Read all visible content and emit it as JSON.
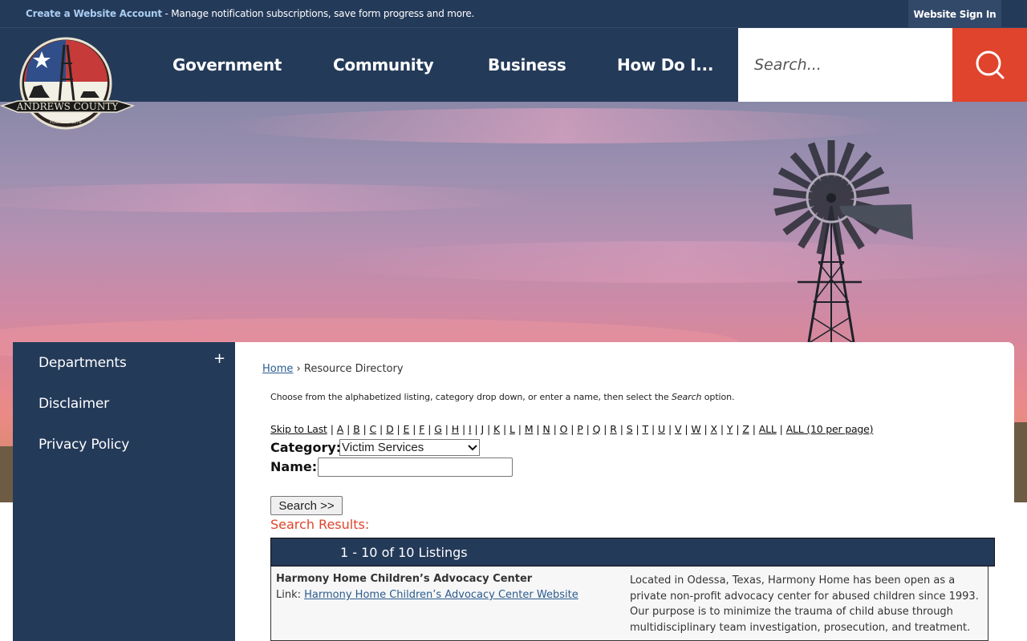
{
  "topbar": {
    "create_account": "Create a Website Account",
    "message": " - Manage notification subscriptions, save form progress and more.",
    "sign_in": "Website Sign In"
  },
  "logo": {
    "text": "ANDREWS COUNTY",
    "subtext": "FOUNDED 1876"
  },
  "nav": {
    "items": [
      "Government",
      "Community",
      "Business",
      "How Do I..."
    ]
  },
  "search": {
    "placeholder": "Search..."
  },
  "sidebar": {
    "items": [
      "Departments",
      "Disclaimer",
      "Privacy Policy"
    ],
    "expand_symbol": "+"
  },
  "breadcrumb": {
    "home": "Home",
    "separator": "›",
    "current": "Resource Directory"
  },
  "intro": {
    "text": "Choose from the alphabetized listing, category drop down, or enter a name, then select the ",
    "search_word": "Search",
    "suffix": " option."
  },
  "alphabet": {
    "skip_to_last": "Skip to Last",
    "letters": [
      "A",
      "B",
      "C",
      "D",
      "E",
      "F",
      "G",
      "H",
      "I",
      "J",
      "K",
      "L",
      "M",
      "N",
      "O",
      "P",
      "Q",
      "R",
      "S",
      "T",
      "U",
      "V",
      "W",
      "X",
      "Y",
      "Z"
    ],
    "all": "ALL",
    "all_paged": "ALL (10 per page)"
  },
  "form": {
    "category_label": "Category:",
    "category_value": "Victim Services",
    "name_label": "Name:",
    "name_value": "",
    "search_button": "Search >>"
  },
  "results": {
    "label": "Search Results:",
    "count_text": "1 - 10 of 10 Listings",
    "listings": [
      {
        "name": "Harmony Home Children’s Advocacy Center",
        "link_prefix": "Link: ",
        "link_text": "Harmony Home Children’s Advocacy Center Website",
        "description": "Located in Odessa, Texas, Harmony Home has been open as a private non-profit advocacy center for abused children since 1993. Our purpose is to minimize the trauma of child abuse through multidisciplinary team investigation, prosecution, and treatment."
      }
    ]
  },
  "colors": {
    "navy": "#243a59",
    "accent": "#e0442c",
    "link": "#2a5b8f"
  }
}
